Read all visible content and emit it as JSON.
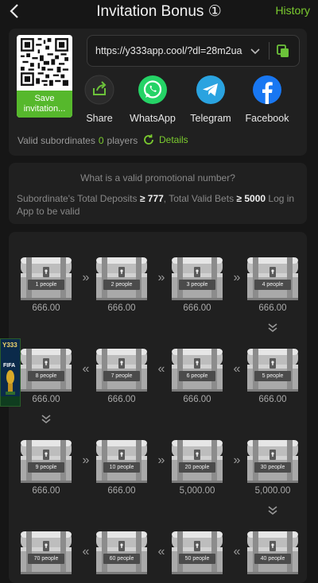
{
  "header": {
    "title": "Invitation Bonus ①",
    "history_label": "History"
  },
  "share": {
    "qr_label": "Save invitation...",
    "link": "https://y333app.cool/?dl=28m2ua",
    "items": [
      {
        "label": "Share",
        "icon": "share-icon",
        "color": "#2a2a2a"
      },
      {
        "label": "WhatsApp",
        "icon": "whatsapp-icon",
        "color": "#25d366"
      },
      {
        "label": "Telegram",
        "icon": "telegram-icon",
        "color": "#2aa3e0"
      },
      {
        "label": "Facebook",
        "icon": "facebook-icon",
        "color": "#1877f2"
      }
    ],
    "valid_label": "Valid subordinates",
    "valid_count": "0",
    "players_label": "players",
    "details_label": "Details"
  },
  "info": {
    "question": "What is a valid promotional number?",
    "rule_prefix": "Subordinate's Total Deposits",
    "deposit_value": "≥ 777",
    "rule_middle": ", Total Valid Bets",
    "bet_value": "≥ 5000",
    "rule_suffix": "Log in App to be valid"
  },
  "rewards": [
    {
      "label": "1 people",
      "amount": "666.00"
    },
    {
      "label": "2 people",
      "amount": "666.00"
    },
    {
      "label": "3 people",
      "amount": "666.00"
    },
    {
      "label": "4 people",
      "amount": "666.00"
    },
    {
      "label": "5 people",
      "amount": "666.00"
    },
    {
      "label": "6 people",
      "amount": "666.00"
    },
    {
      "label": "7 people",
      "amount": "666.00"
    },
    {
      "label": "8 people",
      "amount": "666.00"
    },
    {
      "label": "9 people",
      "amount": "666.00"
    },
    {
      "label": "10 people",
      "amount": "666.00"
    },
    {
      "label": "20 people",
      "amount": "5,000.00"
    },
    {
      "label": "30 people",
      "amount": "5,000.00"
    },
    {
      "label": "40 people",
      "amount": ""
    },
    {
      "label": "50 people",
      "amount": ""
    },
    {
      "label": "60 people",
      "amount": ""
    },
    {
      "label": "70 people",
      "amount": ""
    }
  ],
  "ad": {
    "brand": "Y333",
    "caption": "FIFA"
  },
  "colors": {
    "accent": "#7bcb2f",
    "background": "#161616",
    "card": "#202020"
  }
}
